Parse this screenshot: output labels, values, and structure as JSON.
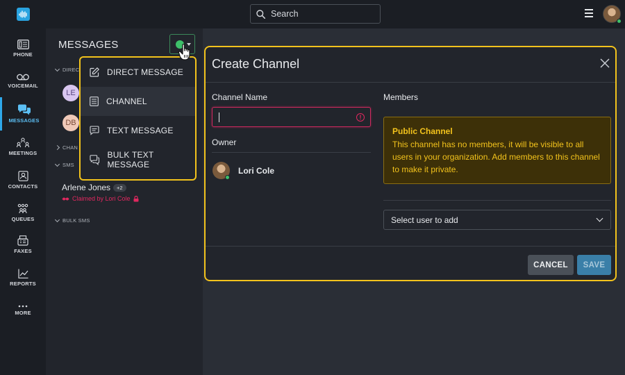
{
  "nav": {
    "items": [
      {
        "key": "phone",
        "label": "PHONE",
        "icon": "phone-icon"
      },
      {
        "key": "voicemail",
        "label": "VOICEMAIL",
        "icon": "voicemail-icon"
      },
      {
        "key": "messages",
        "label": "MESSAGES",
        "icon": "messages-icon"
      },
      {
        "key": "meetings",
        "label": "MEETINGS",
        "icon": "meetings-icon"
      },
      {
        "key": "contacts",
        "label": "CONTACTS",
        "icon": "contacts-icon"
      },
      {
        "key": "queues",
        "label": "QUEUES",
        "icon": "queues-icon"
      },
      {
        "key": "faxes",
        "label": "FAXES",
        "icon": "fax-icon"
      },
      {
        "key": "reports",
        "label": "REPORTS",
        "icon": "reports-icon"
      },
      {
        "key": "more",
        "label": "MORE",
        "icon": "more-icon"
      }
    ],
    "active": "messages"
  },
  "topbar": {
    "search_placeholder": "Search"
  },
  "messages": {
    "title": "MESSAGES",
    "sections": {
      "direct": "DIREC",
      "channels": "CHAN",
      "sms": "SMS",
      "bulk_sms": "BULK SMS"
    },
    "contacts": [
      {
        "initials": "LE"
      },
      {
        "initials": "DB"
      }
    ],
    "sms_item": {
      "name": "Arlene Jones",
      "badge": "+2",
      "claimed": "Claimed by Lori Cole"
    }
  },
  "compose_menu": {
    "items": [
      {
        "label": "DIRECT MESSAGE",
        "icon": "edit-icon"
      },
      {
        "label": "CHANNEL",
        "icon": "channel-icon"
      },
      {
        "label": "TEXT MESSAGE",
        "icon": "text-message-icon"
      },
      {
        "label": "BULK TEXT MESSAGE",
        "icon": "bulk-text-icon"
      }
    ],
    "highlighted": 1
  },
  "modal": {
    "title": "Create Channel",
    "channel_name_label": "Channel Name",
    "channel_name_value": "",
    "owner_label": "Owner",
    "owner_name": "Lori Cole",
    "members_label": "Members",
    "notice_title": "Public Channel",
    "notice_body": "This channel has no members, it will be visible to all users in your organization. Add members to this channel to make it private.",
    "select_user_placeholder": "Select user to add",
    "cancel_label": "CANCEL",
    "save_label": "SAVE"
  },
  "colors": {
    "accent": "#2ea8ea",
    "highlight": "#f3c31c",
    "error": "#e0285f",
    "online": "#3ec06a"
  }
}
